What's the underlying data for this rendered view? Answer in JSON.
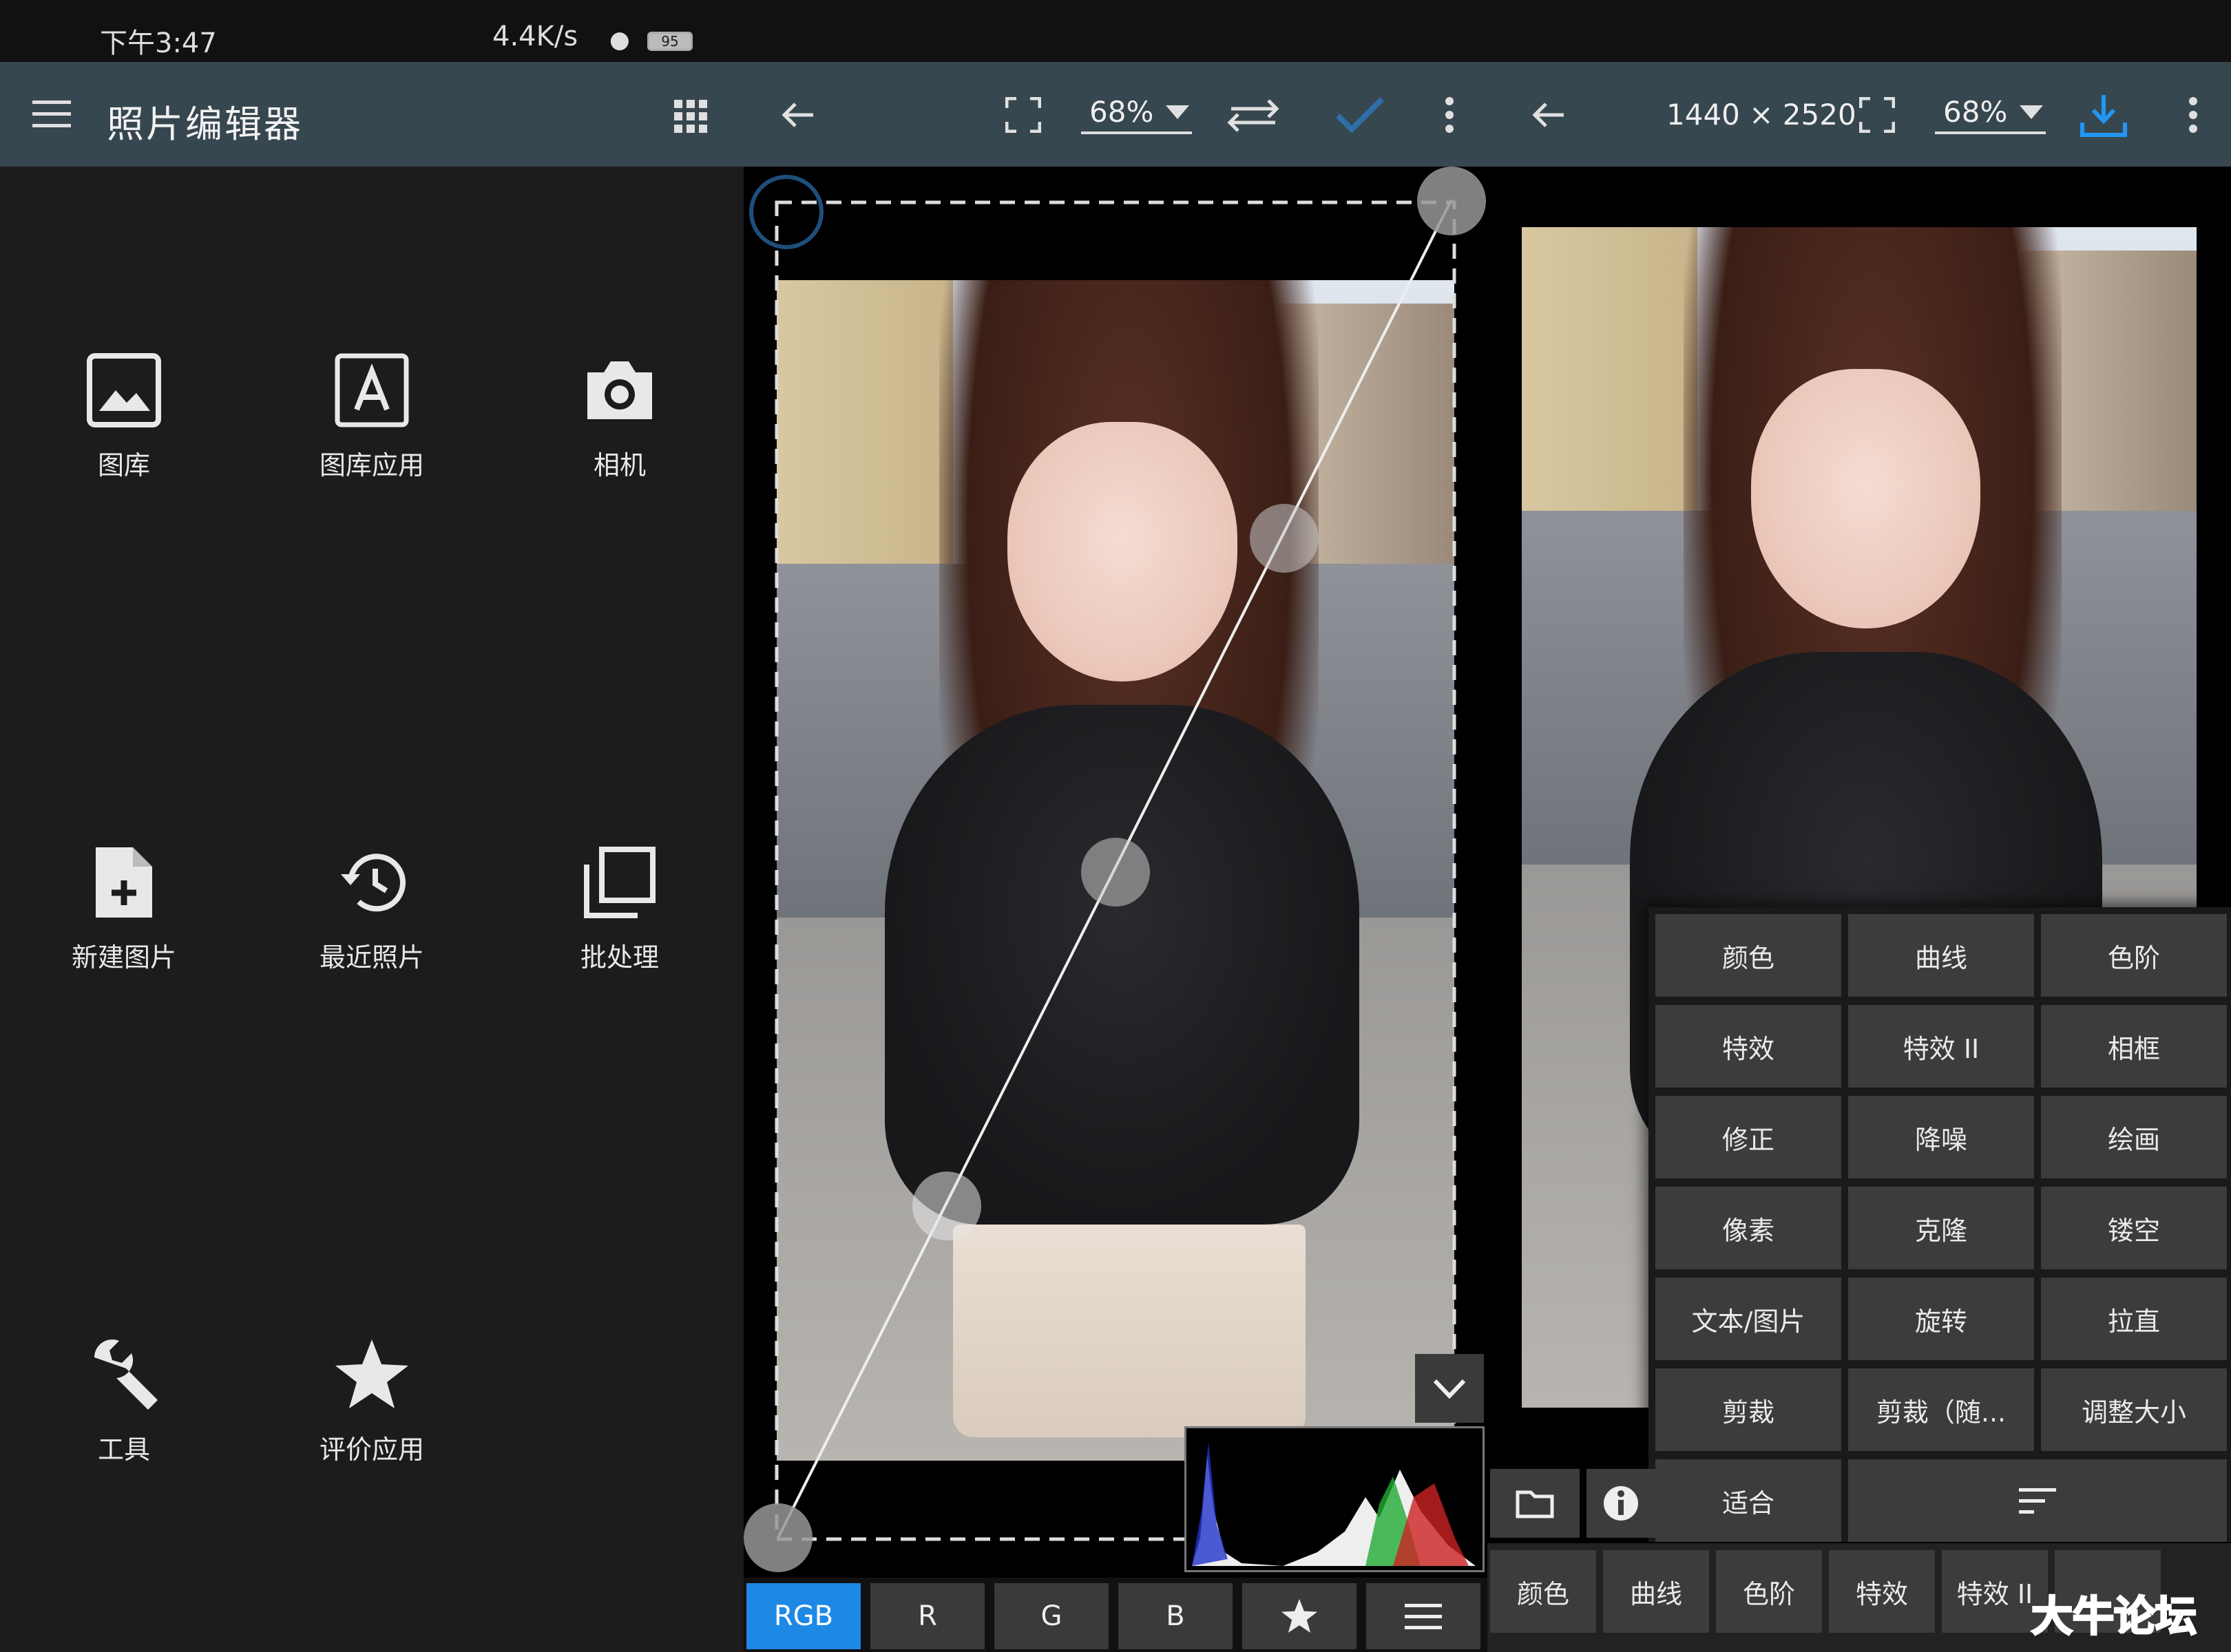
{
  "status": {
    "time": "下午3:47",
    "net": "4.4K/s",
    "battery": "95"
  },
  "left_toolbar": {
    "title": "照片编辑器"
  },
  "mid_toolbar": {
    "zoom": "68%"
  },
  "right_toolbar": {
    "dimensions": "1440 × 2520",
    "zoom": "68%"
  },
  "tiles": [
    {
      "label": "图库"
    },
    {
      "label": "图库应用"
    },
    {
      "label": "相机"
    },
    {
      "label": "新建图片"
    },
    {
      "label": "最近照片"
    },
    {
      "label": "批处理"
    },
    {
      "label": "工具"
    },
    {
      "label": "评价应用"
    }
  ],
  "channels": [
    {
      "label": "RGB",
      "active": true
    },
    {
      "label": "R"
    },
    {
      "label": "G"
    },
    {
      "label": "B"
    }
  ],
  "menu_items": [
    "颜色",
    "曲线",
    "色阶",
    "特效",
    "特效 II",
    "相框",
    "修正",
    "降噪",
    "绘画",
    "像素",
    "克隆",
    "镂空",
    "文本/图片",
    "旋转",
    "拉直",
    "剪裁",
    "剪裁（随...",
    "调整大小",
    "适合"
  ],
  "strip_items": [
    "颜色",
    "曲线",
    "色阶",
    "特效",
    "特效 II"
  ],
  "watermark": "大牛论坛",
  "colors": {
    "toolbar": "#37474f",
    "accent": "#1e88e5",
    "panel": "#1c1c1c"
  }
}
